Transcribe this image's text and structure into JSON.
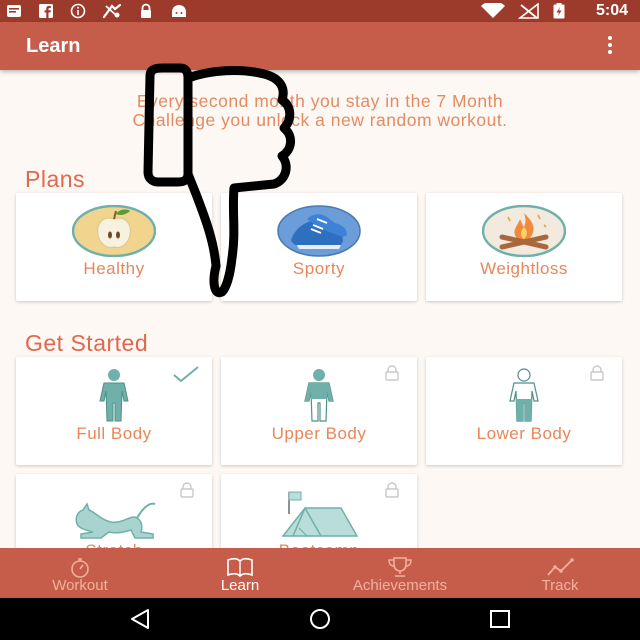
{
  "status_bar": {
    "time": "5:04",
    "left_icons": [
      "message-icon",
      "facebook-icon",
      "info-icon",
      "sports-icon",
      "lock-icon",
      "android-icon"
    ],
    "right_icons": [
      "wifi-icon",
      "no-signal-icon",
      "battery-charging-icon"
    ]
  },
  "app_bar": {
    "title": "Learn",
    "menu_icon": "more-vert-icon"
  },
  "intro": {
    "line1": "Every second month you stay in the 7 Month",
    "line2": "Challenge you unlock a new random workout."
  },
  "plans": {
    "title": "Plans",
    "items": [
      {
        "label": "Healthy",
        "icon": "apple-icon"
      },
      {
        "label": "Sporty",
        "icon": "sneakers-icon"
      },
      {
        "label": "Weightloss",
        "icon": "campfire-icon"
      }
    ]
  },
  "get_started": {
    "title": "Get Started",
    "items": [
      {
        "label": "Full Body",
        "icon": "full-body-figure-icon",
        "status": "completed"
      },
      {
        "label": "Upper Body",
        "icon": "upper-body-figure-icon",
        "status": "locked"
      },
      {
        "label": "Lower Body",
        "icon": "lower-body-figure-icon",
        "status": "locked"
      },
      {
        "label": "Stretch",
        "icon": "cat-stretch-icon",
        "status": "locked"
      },
      {
        "label": "Bootcamp",
        "icon": "tent-icon",
        "status": "locked"
      }
    ]
  },
  "bottom_nav": {
    "items": [
      {
        "label": "Workout",
        "icon": "stopwatch-icon",
        "active": false
      },
      {
        "label": "Learn",
        "icon": "book-icon",
        "active": true
      },
      {
        "label": "Achievements",
        "icon": "trophy-icon",
        "active": false
      },
      {
        "label": "Track",
        "icon": "chart-icon",
        "active": false
      }
    ]
  },
  "system_nav": {
    "buttons": [
      "back-icon",
      "home-icon",
      "recents-icon"
    ]
  },
  "overlay": {
    "icon": "thumbs-down-icon"
  },
  "colors": {
    "status_bar": "#9c3b2b",
    "app_bar": "#c65d4a",
    "background": "#fdf8f3",
    "section_title": "#e2674f",
    "card_label": "#e8865a",
    "teal_icon": "#6fb1aa"
  }
}
